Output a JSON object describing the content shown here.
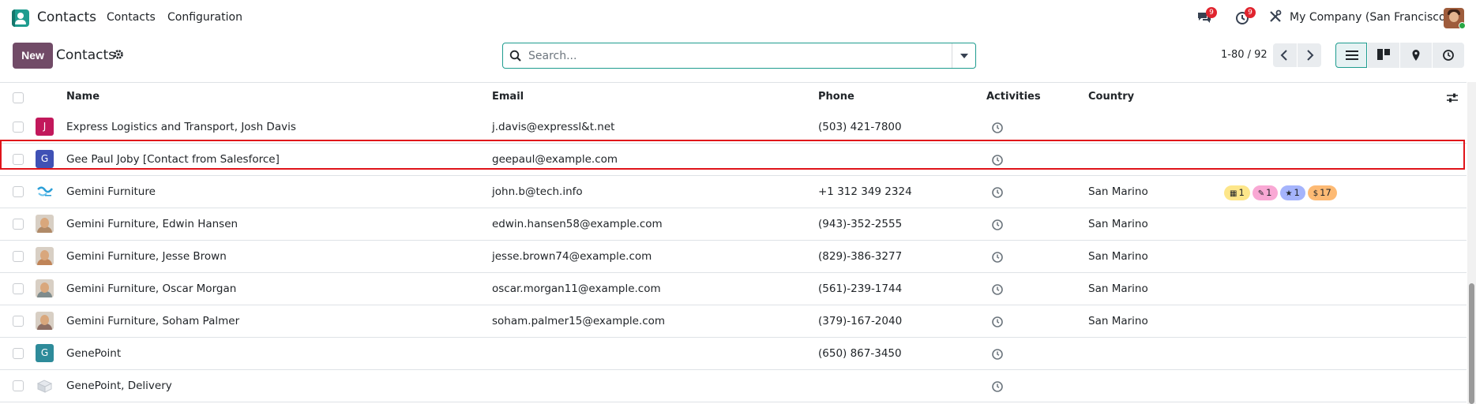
{
  "navbar": {
    "brand": "Contacts",
    "menu": [
      "Contacts",
      "Configuration"
    ],
    "messages_badge": "9",
    "activities_badge": "9",
    "company": "My Company (San Francisco)"
  },
  "control_panel": {
    "new_label": "New",
    "title": "Contacts",
    "search_placeholder": "Search...",
    "pager": "1-80 / 92"
  },
  "columns": [
    "Name",
    "Email",
    "Phone",
    "Activities",
    "Country"
  ],
  "rows": [
    {
      "avatar": "J",
      "avatar_color": "#c2185b",
      "name": "Express Logistics and Transport, Josh Davis",
      "email": "j.davis@expressl&t.net",
      "phone": "(503) 421-7800",
      "country": ""
    },
    {
      "avatar": "G",
      "avatar_color": "#3f51b5",
      "name": "Gee Paul Joby [Contact from Salesforce]",
      "email": "geepaul@example.com",
      "phone": "",
      "country": ""
    },
    {
      "avatar": "logo",
      "name": "Gemini Furniture",
      "email": "john.b@tech.info",
      "phone": "+1 312 349 2324",
      "country": "San Marino",
      "tags": [
        {
          "icon": "calendar-icon",
          "glyph": "▦",
          "count": "1",
          "color": "#fde68a"
        },
        {
          "icon": "edit-icon",
          "glyph": "✎",
          "count": "1",
          "color": "#f9a8d4"
        },
        {
          "icon": "star-icon",
          "glyph": "★",
          "count": "1",
          "color": "#a5b4fc"
        },
        {
          "icon": "dollar-icon",
          "glyph": "$",
          "count": "17",
          "color": "#fdba74"
        }
      ]
    },
    {
      "avatar": "photo",
      "avatar_color": "#b08a68",
      "name": "Gemini Furniture, Edwin Hansen",
      "email": "edwin.hansen58@example.com",
      "phone": "(943)-352-2555",
      "country": "San Marino"
    },
    {
      "avatar": "photo",
      "avatar_color": "#c08458",
      "name": "Gemini Furniture, Jesse Brown",
      "email": "jesse.brown74@example.com",
      "phone": "(829)-386-3277",
      "country": "San Marino"
    },
    {
      "avatar": "photo",
      "avatar_color": "#7f8c8d",
      "name": "Gemini Furniture, Oscar Morgan",
      "email": "oscar.morgan11@example.com",
      "phone": "(561)-239-1744",
      "country": "San Marino"
    },
    {
      "avatar": "photo",
      "avatar_color": "#8d6e63",
      "name": "Gemini Furniture, Soham Palmer",
      "email": "soham.palmer15@example.com",
      "phone": "(379)-167-2040",
      "country": "San Marino"
    },
    {
      "avatar": "G",
      "avatar_color": "#2e8b9a",
      "name": "GenePoint",
      "email": "",
      "phone": "(650) 867-3450",
      "country": ""
    },
    {
      "avatar": "box",
      "name": "GenePoint, Delivery",
      "email": "",
      "phone": "",
      "country": ""
    }
  ],
  "colors": {
    "primary": "#714b67",
    "accent": "#1e9c8f",
    "highlight": "#e0141a"
  }
}
